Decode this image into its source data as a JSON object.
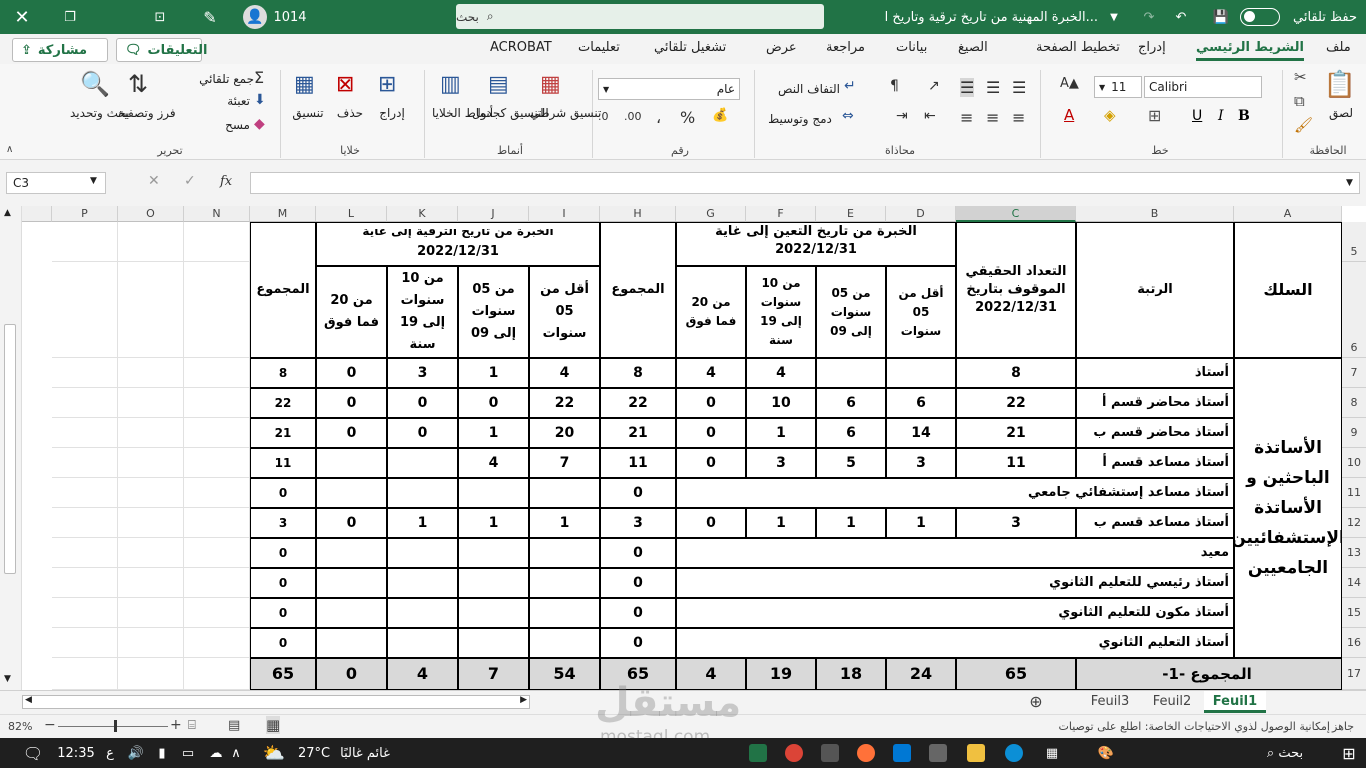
{
  "titlebar": {
    "autosave_label": "حفظ تلقائي",
    "doc_title": "الخبرة المهنية من تاريخ ترقية وتاريخ ا...",
    "search_placeholder": "بحث",
    "user_count": "1014"
  },
  "tabs": [
    "ملف",
    "الشريط الرئيسي",
    "إدراج",
    "تخطيط الصفحة",
    "الصيغ",
    "بيانات",
    "مراجعة",
    "عرض",
    "تشغيل تلقائي",
    "تعليمات",
    "ACROBAT"
  ],
  "active_tab": "الشريط الرئيسي",
  "comments_label": "التعليقات",
  "share_label": "مشاركة",
  "ribbon": {
    "paste": "لصق",
    "clipboard": "الحافظة",
    "font_name": "Calibri",
    "font_size": "11",
    "font_group": "خط",
    "wrap_text": "التفاف النص",
    "merge_center": "دمج وتوسيط",
    "alignment_group": "محاذاة",
    "number_format": "عام",
    "number_group": "رقم",
    "cond_format": "تنسيق شرطي",
    "format_table": "التنسيق كجدول",
    "cell_styles": "أنماط الخلايا",
    "styles_group": "أنماط",
    "insert": "إدراج",
    "delete": "حذف",
    "format": "تنسيق",
    "cells_group": "خلايا",
    "autosum": "جمع تلقائي",
    "fill": "تعبئة",
    "clear": "مسح",
    "sort_filter": "فرز وتصفية",
    "find_select": "بحث وتحديد",
    "editing_group": "تحرير"
  },
  "namebox": "C3",
  "columns": [
    "A",
    "B",
    "C",
    "D",
    "E",
    "F",
    "G",
    "H",
    "I",
    "J",
    "K",
    "L",
    "M",
    "N",
    "O",
    "P"
  ],
  "rows": [
    "5",
    "6",
    "7",
    "8",
    "9",
    "10",
    "11",
    "12",
    "13",
    "14",
    "15",
    "16",
    "17"
  ],
  "header": {
    "silk": "السلك",
    "rank": "الرتبة",
    "actual_count": "التعداد الحقيقي الموقوف بتاريخ 2022/12/31",
    "exp_group1": "الخبرة من تاريخ التعين إلى غاية 2022/12/31",
    "exp_group2_partial": "2022/12/31",
    "exp_group2_top": "الخبرة من تاريخ الترقية إلى غاية",
    "lt5": "أقل من 05 سنوات",
    "5to9": "من 05 سنوات إلى 09",
    "10to19": "من 10 سنوات إلى 19 سنة",
    "20plus": "من 20 فما فوق",
    "total": "المجموع"
  },
  "silk_name": "الأساتذة الباحثين و الأساتذة الإستشفائيين الجامعيين",
  "table_rows": [
    {
      "rank": "أستاذ",
      "c": "8",
      "d": "",
      "e": "",
      "f": "4",
      "g": "4",
      "h": "8",
      "i": "4",
      "j": "1",
      "k": "3",
      "l": "0",
      "m": "8"
    },
    {
      "rank": "أستاذ محاضر قسم أ",
      "c": "22",
      "d": "6",
      "e": "6",
      "f": "10",
      "g": "0",
      "h": "22",
      "i": "22",
      "j": "0",
      "k": "0",
      "l": "0",
      "m": "22"
    },
    {
      "rank": "أستاذ محاضر قسم ب",
      "c": "21",
      "d": "14",
      "e": "6",
      "f": "1",
      "g": "0",
      "h": "21",
      "i": "20",
      "j": "1",
      "k": "0",
      "l": "0",
      "m": "21"
    },
    {
      "rank": "أستاذ مساعد قسم أ",
      "c": "11",
      "d": "3",
      "e": "5",
      "f": "3",
      "g": "0",
      "h": "11",
      "i": "7",
      "j": "4",
      "k": "",
      "l": "",
      "m": "11"
    },
    {
      "rank": "أستاذ مساعد إستشفائي جامعي",
      "c": "",
      "d": "",
      "e": "",
      "f": "",
      "g": "",
      "h": "0",
      "i": "",
      "j": "",
      "k": "",
      "l": "",
      "m": "0"
    },
    {
      "rank": "أستاذ  مساعد قسم ب",
      "c": "3",
      "d": "1",
      "e": "1",
      "f": "1",
      "g": "0",
      "h": "3",
      "i": "1",
      "j": "1",
      "k": "1",
      "l": "0",
      "m": "3"
    },
    {
      "rank": "معيد",
      "c": "",
      "d": "",
      "e": "",
      "f": "",
      "g": "",
      "h": "0",
      "i": "",
      "j": "",
      "k": "",
      "l": "",
      "m": "0"
    },
    {
      "rank": "أستاذ رئيسي للتعليم الثانوي",
      "c": "",
      "d": "",
      "e": "",
      "f": "",
      "g": "",
      "h": "0",
      "i": "",
      "j": "",
      "k": "",
      "l": "",
      "m": "0"
    },
    {
      "rank": "أستاذ مكون للتعليم الثانوي",
      "c": "",
      "d": "",
      "e": "",
      "f": "",
      "g": "",
      "h": "0",
      "i": "",
      "j": "",
      "k": "",
      "l": "",
      "m": "0"
    },
    {
      "rank": "أستاذ التعليم الثانوي",
      "c": "",
      "d": "",
      "e": "",
      "f": "",
      "g": "",
      "h": "0",
      "i": "",
      "j": "",
      "k": "",
      "l": "",
      "m": "0"
    }
  ],
  "total_row": {
    "label": "المجموع -1-",
    "c": "65",
    "d": "24",
    "e": "18",
    "f": "19",
    "g": "4",
    "h": "65",
    "i": "54",
    "j": "7",
    "k": "4",
    "l": "0",
    "m": "65"
  },
  "sheets": [
    "Feuil1",
    "Feuil2",
    "Feuil3"
  ],
  "active_sheet": "Feuil1",
  "status": {
    "ready": "جاهز",
    "accessibility": "إمكانية الوصول لذوي الاحتياجات الخاصة: اطلع على توصيات",
    "zoom": "82%"
  },
  "taskbar": {
    "time": "12:35",
    "lang": "ع",
    "weather_temp": "27°C",
    "weather_desc": "غائم غالبًا",
    "search": "بحث"
  },
  "watermark": {
    "arabic": "مستقل",
    "latin": "mostaql.com"
  }
}
